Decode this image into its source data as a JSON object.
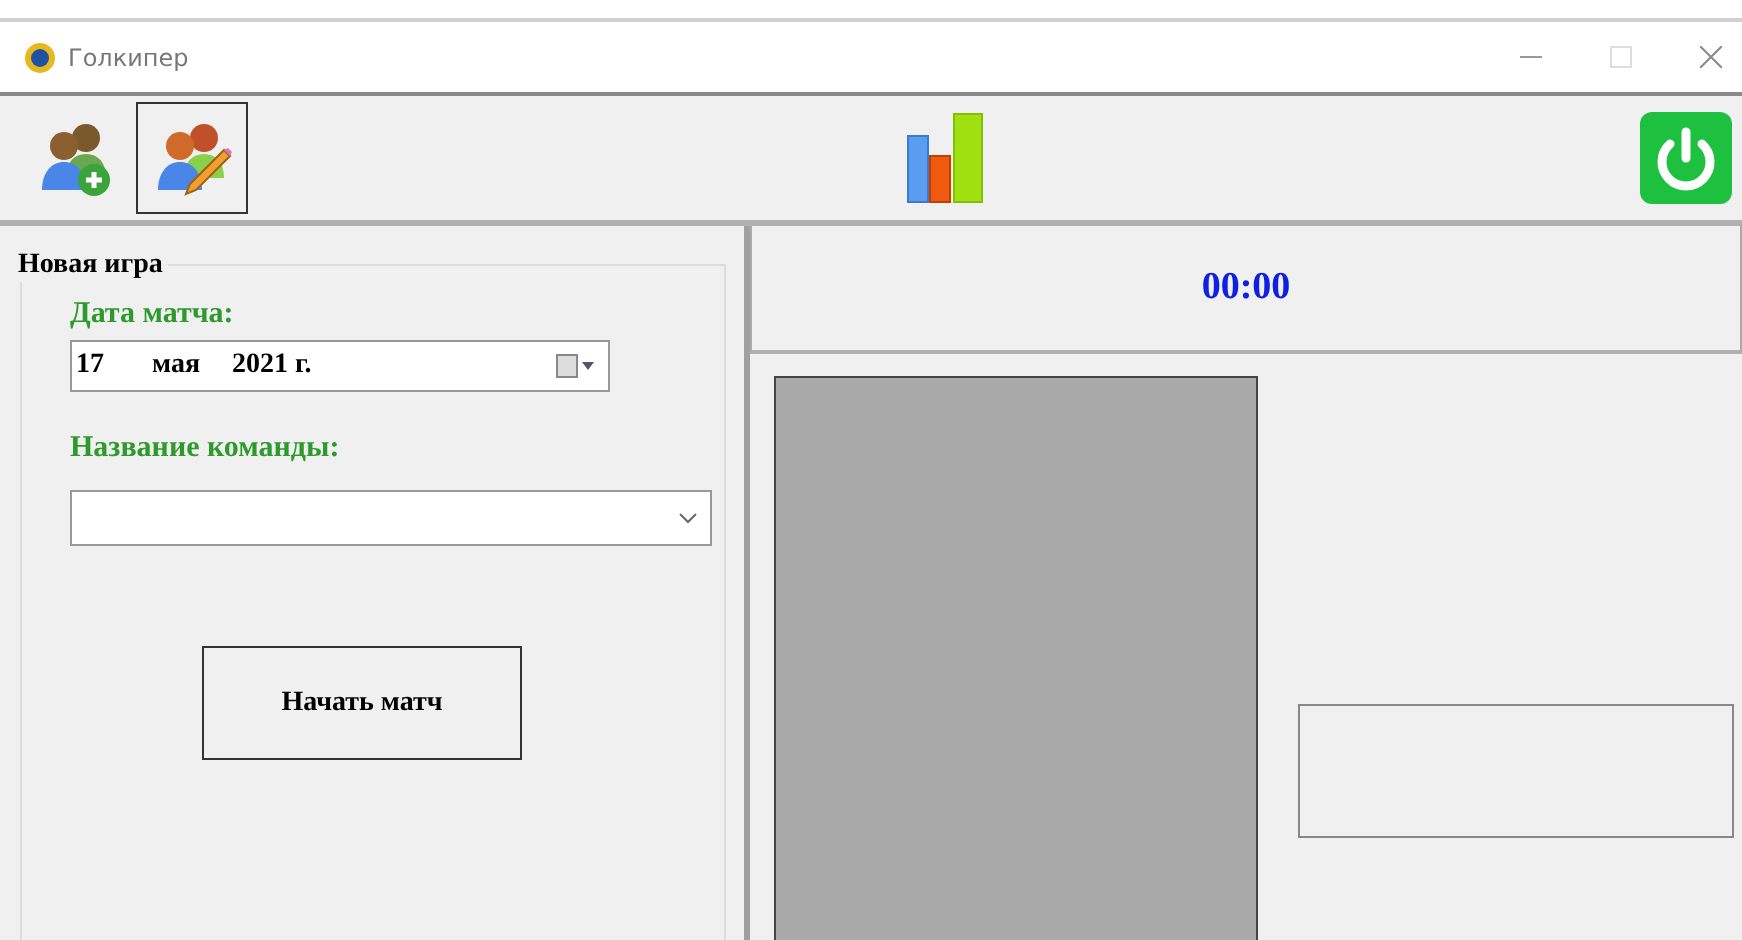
{
  "window": {
    "title": "Голкипер"
  },
  "toolbar": [
    {
      "kind": "add-players",
      "selected": false
    },
    {
      "kind": "edit-players",
      "selected": true
    }
  ],
  "new_game": {
    "title": "Новая игра",
    "date_label": "Дата матча:",
    "date": {
      "day": "17",
      "month": "мая",
      "year": "2021 г."
    },
    "team_label": "Название команды:",
    "start_button": "Начать матч"
  },
  "timer": "00:00"
}
